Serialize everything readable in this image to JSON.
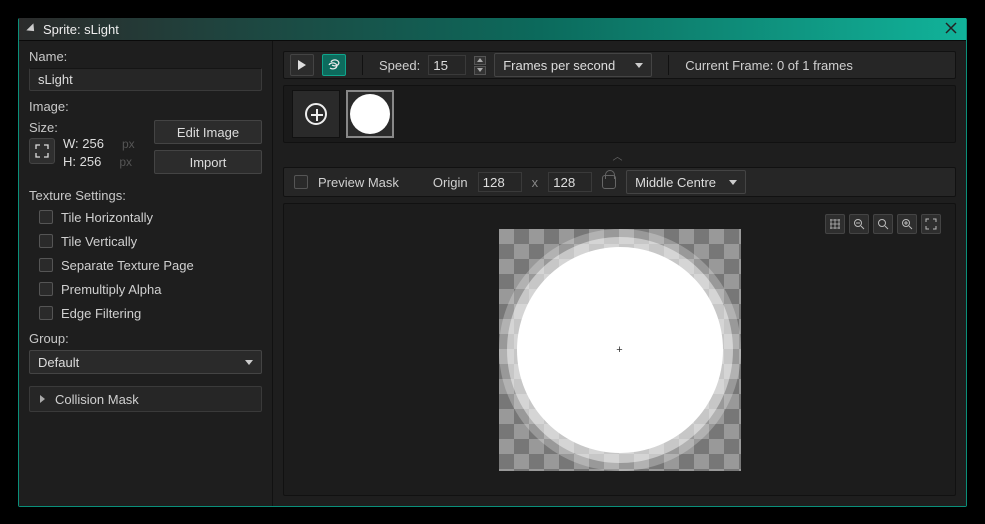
{
  "window": {
    "title": "Sprite: sLight"
  },
  "left": {
    "name_label": "Name:",
    "name_value": "sLight",
    "image_label": "Image:",
    "size_label": "Size:",
    "width_label": "W: 256",
    "height_label": "H: 256",
    "px": "px",
    "edit_image": "Edit Image",
    "import": "Import",
    "texture_settings": "Texture Settings:",
    "tile_h": "Tile Horizontally",
    "tile_v": "Tile Vertically",
    "sep_page": "Separate Texture Page",
    "premult": "Premultiply Alpha",
    "edge_filter": "Edge Filtering",
    "group_label": "Group:",
    "group_value": "Default",
    "collision": "Collision Mask"
  },
  "top": {
    "speed_label": "Speed:",
    "speed_value": "15",
    "fps_label": "Frames per second",
    "current_frame": "Current Frame: 0 of 1 frames"
  },
  "origin": {
    "preview_mask": "Preview Mask",
    "origin_label": "Origin",
    "x": "128",
    "sep": "x",
    "y": "128",
    "anchor": "Middle Centre"
  }
}
